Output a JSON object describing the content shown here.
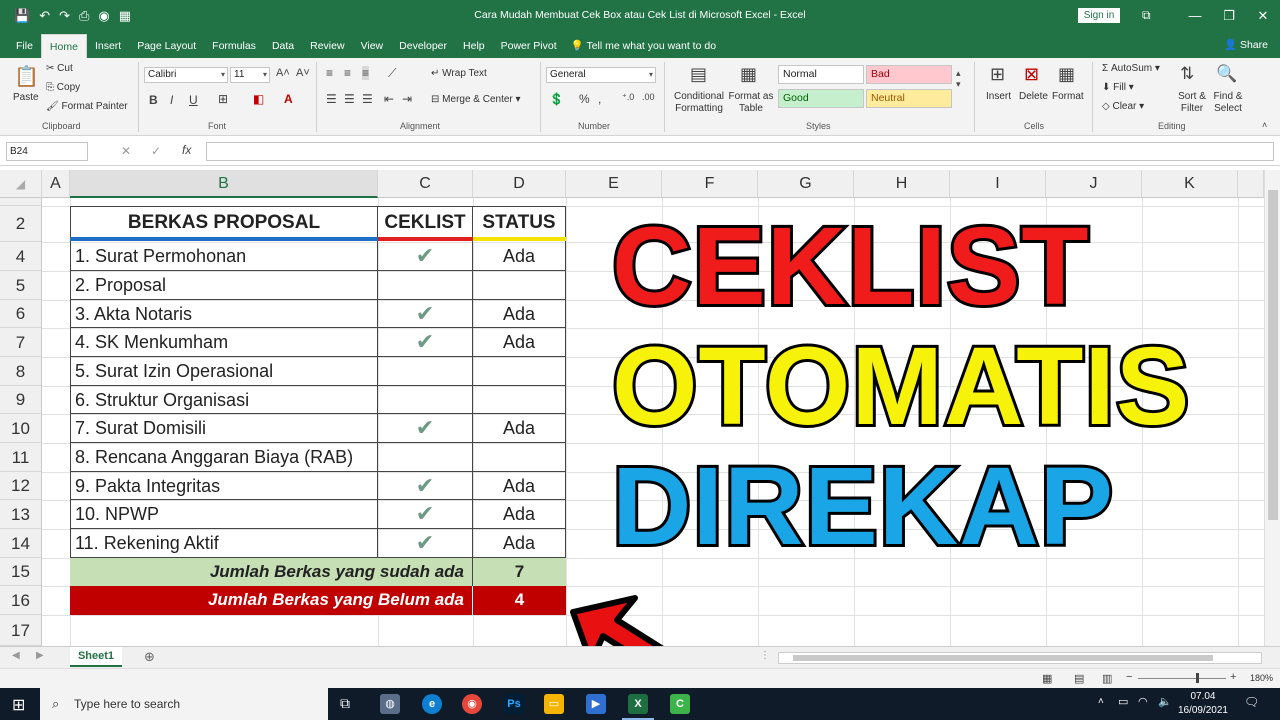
{
  "window": {
    "title": "Cara Mudah Membuat Cek Box atau Cek List di Microsoft Excel  -  Excel",
    "sign_in": "Sign in",
    "share": "Share"
  },
  "tabs": [
    "File",
    "Home",
    "Insert",
    "Page Layout",
    "Formulas",
    "Data",
    "Review",
    "View",
    "Developer",
    "Help",
    "Power Pivot"
  ],
  "active_tab": "Home",
  "tell_me": "Tell me what you want to do",
  "ribbon": {
    "clipboard": {
      "label": "Clipboard",
      "paste": "Paste",
      "cut": "Cut",
      "copy": "Copy",
      "format_painter": "Format Painter"
    },
    "font": {
      "label": "Font",
      "name": "Calibri",
      "size": "11"
    },
    "alignment": {
      "label": "Alignment",
      "wrap_text": "Wrap Text",
      "merge_center": "Merge & Center"
    },
    "number": {
      "label": "Number",
      "format": "General"
    },
    "styles": {
      "label": "Styles",
      "conditional_formatting": "Conditional Formatting",
      "format_as_table": "Format as Table",
      "normal": "Normal",
      "bad": "Bad",
      "good": "Good",
      "neutral": "Neutral"
    },
    "cells": {
      "label": "Cells",
      "insert": "Insert",
      "delete": "Delete",
      "format": "Format"
    },
    "editing": {
      "label": "Editing",
      "autosum": "AutoSum",
      "fill": "Fill",
      "clear": "Clear",
      "sort_filter": "Sort & Filter",
      "find_select": "Find & Select"
    }
  },
  "formula_bar": {
    "name_box": "B24",
    "formula": ""
  },
  "columns": [
    "A",
    "B",
    "C",
    "D",
    "E",
    "F",
    "G",
    "H",
    "I",
    "J",
    "K"
  ],
  "selected_column": "B",
  "rows": [
    "2",
    "4",
    "5",
    "6",
    "7",
    "8",
    "9",
    "10",
    "11",
    "12",
    "13",
    "14",
    "15",
    "16",
    "17"
  ],
  "table": {
    "headers": {
      "berkas": "BERKAS PROPOSAL",
      "ceklist": "CEKLIST",
      "status": "STATUS"
    },
    "items": [
      {
        "name": "1. Surat Permohonan",
        "checked": true,
        "status": "Ada"
      },
      {
        "name": "2. Proposal",
        "checked": false,
        "status": ""
      },
      {
        "name": "3. Akta Notaris",
        "checked": true,
        "status": "Ada"
      },
      {
        "name": "4. SK Menkumham",
        "checked": true,
        "status": "Ada"
      },
      {
        "name": "5. Surat Izin Operasional",
        "checked": false,
        "status": ""
      },
      {
        "name": "6. Struktur Organisasi",
        "checked": false,
        "status": ""
      },
      {
        "name": "7. Surat Domisili",
        "checked": true,
        "status": "Ada"
      },
      {
        "name": "8. Rencana Anggaran Biaya (RAB)",
        "checked": false,
        "status": ""
      },
      {
        "name": "9. Pakta Integritas",
        "checked": true,
        "status": "Ada"
      },
      {
        "name": "10. NPWP",
        "checked": true,
        "status": "Ada"
      },
      {
        "name": "11. Rekening Aktif",
        "checked": true,
        "status": "Ada"
      }
    ],
    "summary_done_label": "Jumlah Berkas yang sudah ada",
    "summary_done_value": "7",
    "summary_missing_label": "Jumlah Berkas yang Belum ada",
    "summary_missing_value": "4"
  },
  "overlay_text": {
    "line1": "CEKLIST",
    "line2": "OTOMATIS",
    "line3": "DIREKAP"
  },
  "colors": {
    "excel_green": "#217346",
    "red": "#f01c1c",
    "yellow": "#f7f20a",
    "blue": "#1aa6e6",
    "sum_done_bg": "#c6dfb4",
    "sum_missing_bg": "#c00000"
  },
  "sheet_tab": "Sheet1",
  "zoom": "180%",
  "taskbar": {
    "search_placeholder": "Type here to search",
    "time": "07.04",
    "date": "16/09/2021"
  }
}
